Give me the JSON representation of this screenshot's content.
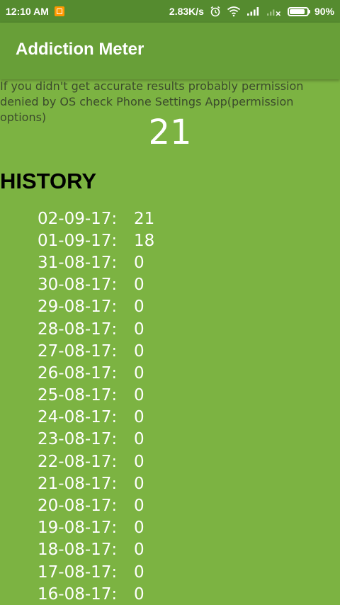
{
  "status_bar": {
    "time": "12:10 AM",
    "speed": "2.83K/s",
    "battery": "90%",
    "battery_level": 90,
    "icons": [
      "app-notification-icon",
      "alarm-icon",
      "wifi-icon",
      "signal-icon",
      "signal-x-icon",
      "battery-icon"
    ]
  },
  "app_bar": {
    "title": "Addiction Meter"
  },
  "notice": "If you didn't get accurate results probably permission denied by OS check Phone Settings App(permission options)",
  "current_count": "21",
  "history": {
    "heading": "HISTORY",
    "rows": [
      {
        "date": "02-09-17:",
        "value": "21"
      },
      {
        "date": "01-09-17:",
        "value": "18"
      },
      {
        "date": "31-08-17:",
        "value": "0"
      },
      {
        "date": "30-08-17:",
        "value": "0"
      },
      {
        "date": "29-08-17:",
        "value": "0"
      },
      {
        "date": "28-08-17:",
        "value": "0"
      },
      {
        "date": "27-08-17:",
        "value": "0"
      },
      {
        "date": "26-08-17:",
        "value": "0"
      },
      {
        "date": "25-08-17:",
        "value": "0"
      },
      {
        "date": "24-08-17:",
        "value": "0"
      },
      {
        "date": "23-08-17:",
        "value": "0"
      },
      {
        "date": "22-08-17:",
        "value": "0"
      },
      {
        "date": "21-08-17:",
        "value": "0"
      },
      {
        "date": "20-08-17:",
        "value": "0"
      },
      {
        "date": "19-08-17:",
        "value": "0"
      },
      {
        "date": "18-08-17:",
        "value": "0"
      },
      {
        "date": "17-08-17:",
        "value": "0"
      },
      {
        "date": "16-08-17:",
        "value": "0"
      }
    ]
  },
  "colors": {
    "background": "#7cb342",
    "app_bar": "#689f38",
    "status_bar": "#558b2f",
    "notice_text": "#3b4a2c"
  }
}
